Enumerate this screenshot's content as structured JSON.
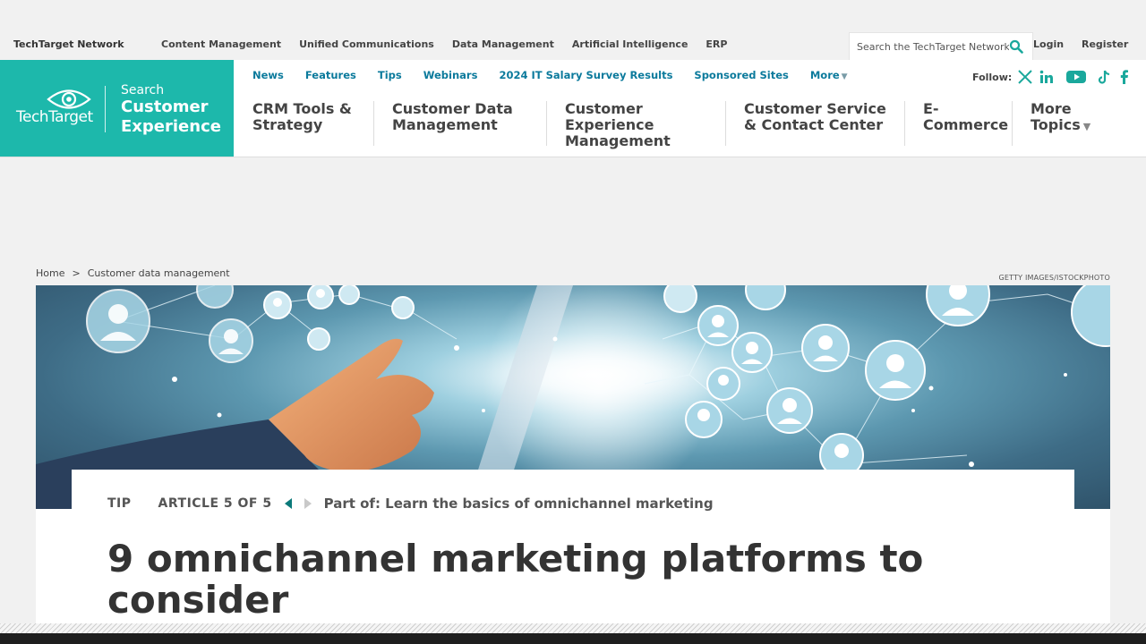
{
  "network": {
    "title": "TechTarget Network",
    "links": [
      "Content Management",
      "Unified Communications",
      "Data Management",
      "Artificial Intelligence",
      "ERP"
    ],
    "search_placeholder": "Search the TechTarget Network",
    "login": "Login",
    "register": "Register"
  },
  "brand": {
    "logo_text": "TechTarget",
    "site_prefix": "Search",
    "site_name": "Customer Experience",
    "color": "#1db8ab"
  },
  "subnav": {
    "items": [
      "News",
      "Features",
      "Tips",
      "Webinars",
      "2024 IT Salary Survey Results",
      "Sponsored Sites",
      "More"
    ],
    "follow_label": "Follow:",
    "social_icons": [
      "x-icon",
      "linkedin-icon",
      "youtube-icon",
      "tiktok-icon",
      "facebook-icon"
    ]
  },
  "topics": [
    "CRM Tools & Strategy",
    "Customer Data Management",
    "Customer Experience Management",
    "Customer Service & Contact Center",
    "E-Commerce",
    "More Topics"
  ],
  "breadcrumb": {
    "home": "Home",
    "separator": ">",
    "current": "Customer data management"
  },
  "hero": {
    "credit": "GETTY IMAGES/ISTOCKPHOTO"
  },
  "article": {
    "type": "TIP",
    "position": "ARTICLE 5 OF 5",
    "series": "Part of: Learn the basics of omnichannel marketing",
    "title": "9 omnichannel marketing platforms to consider"
  }
}
